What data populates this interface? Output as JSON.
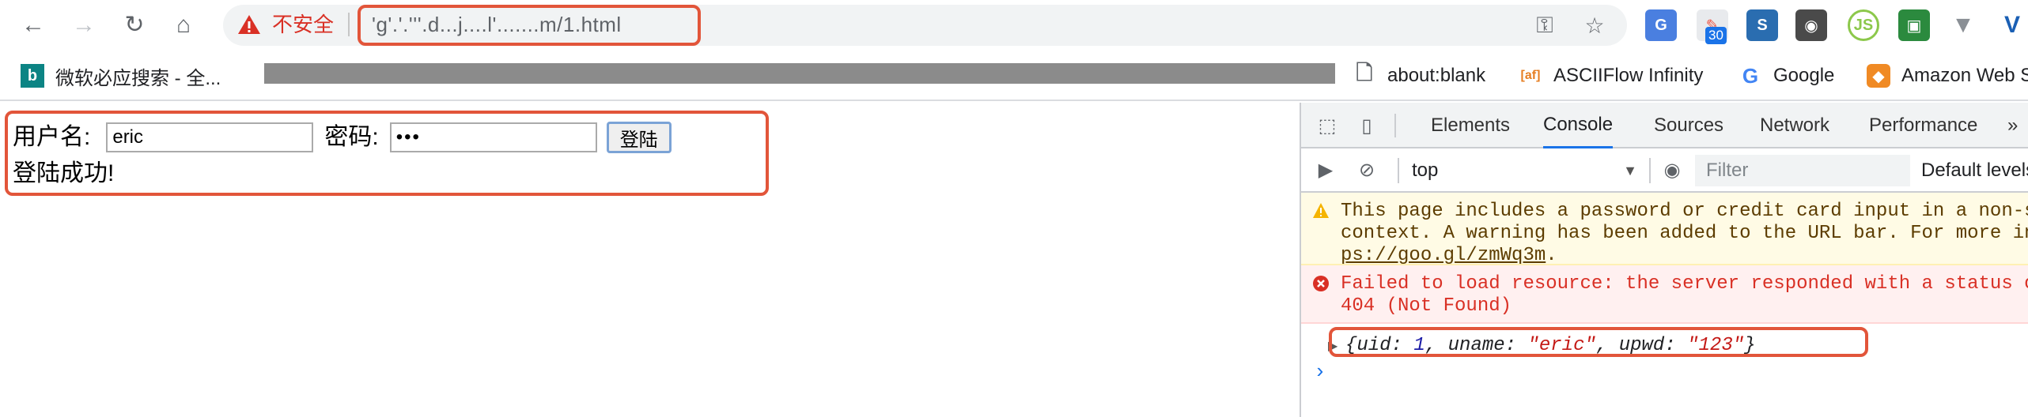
{
  "browser": {
    "security_label": "不安全",
    "url": "'g'.'.'''.d...j....l'.......m/1.html"
  },
  "bookmarks": [
    {
      "label": "微软必应搜索 - 全...",
      "icon": "bing-icon"
    },
    {
      "label": "about:blank",
      "icon": "page-icon"
    },
    {
      "label": "ASCIIFlow Infinity",
      "icon": "asciiflow-icon"
    },
    {
      "label": "Google",
      "icon": "google-icon"
    },
    {
      "label": "Amazon Web S",
      "icon": "aws-icon"
    }
  ],
  "extensions": {
    "badge_count": "30"
  },
  "form": {
    "username_label": "用户名:",
    "username_value": "eric",
    "password_label": "密码:",
    "password_value": "•••",
    "login_button": "登陆",
    "result_text": "登陆成功!"
  },
  "devtools": {
    "tabs": [
      "Elements",
      "Console",
      "Sources",
      "Network",
      "Performance"
    ],
    "active_tab": "Console",
    "more": "»",
    "context": "top",
    "filter_placeholder": "Filter",
    "levels": "Default levels",
    "warning_line1": "This page includes a password or credit card input in a non-secure",
    "warning_line2": "context. A warning has been added to the URL bar. For more info, see htt",
    "warning_link": "ps://goo.gl/zmWq3m",
    "warning_tail": ".",
    "error_line1": "Failed to load resource: the server responded with a status of",
    "error_line2": "404 (Not Found)",
    "object_log": {
      "open": "{",
      "k1": "uid: ",
      "v1": "1",
      "sep1": ", ",
      "k2": "uname: ",
      "v2": "\"eric\"",
      "sep2": ", ",
      "k3": "upwd: ",
      "v3": "\"123\"",
      "close": "}"
    },
    "prompt": "›"
  },
  "colors": {
    "highlight": "#e2553a",
    "insecure": "#d93025",
    "accent": "#1a73e8"
  }
}
